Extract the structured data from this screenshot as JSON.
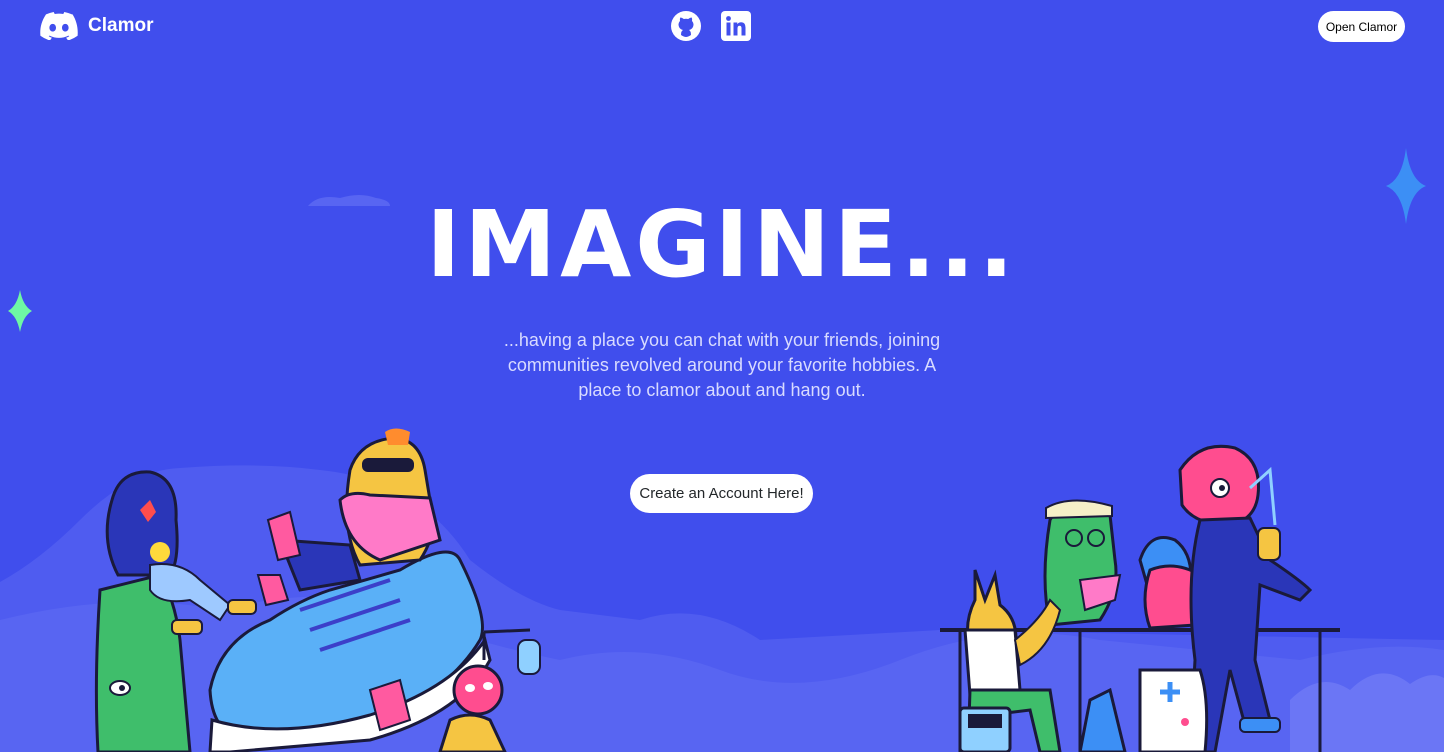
{
  "header": {
    "brand_name": "Clamor",
    "open_button_label": "Open Clamor",
    "social_links": [
      {
        "icon": "github-icon"
      },
      {
        "icon": "linkedin-icon"
      }
    ]
  },
  "hero": {
    "title": "IMAGINE...",
    "description": "...having a place you can chat with your friends, joining communities revolved around your favorite hobbies. A place to clamor about and hang out.",
    "cta_label": "Create an Account Here!"
  },
  "colors": {
    "background": "#404eed",
    "hills": "#5865f2",
    "button_bg": "#ffffff",
    "sparkle_blue": "#3c8ff5",
    "sparkle_green": "#6ef7a4"
  }
}
